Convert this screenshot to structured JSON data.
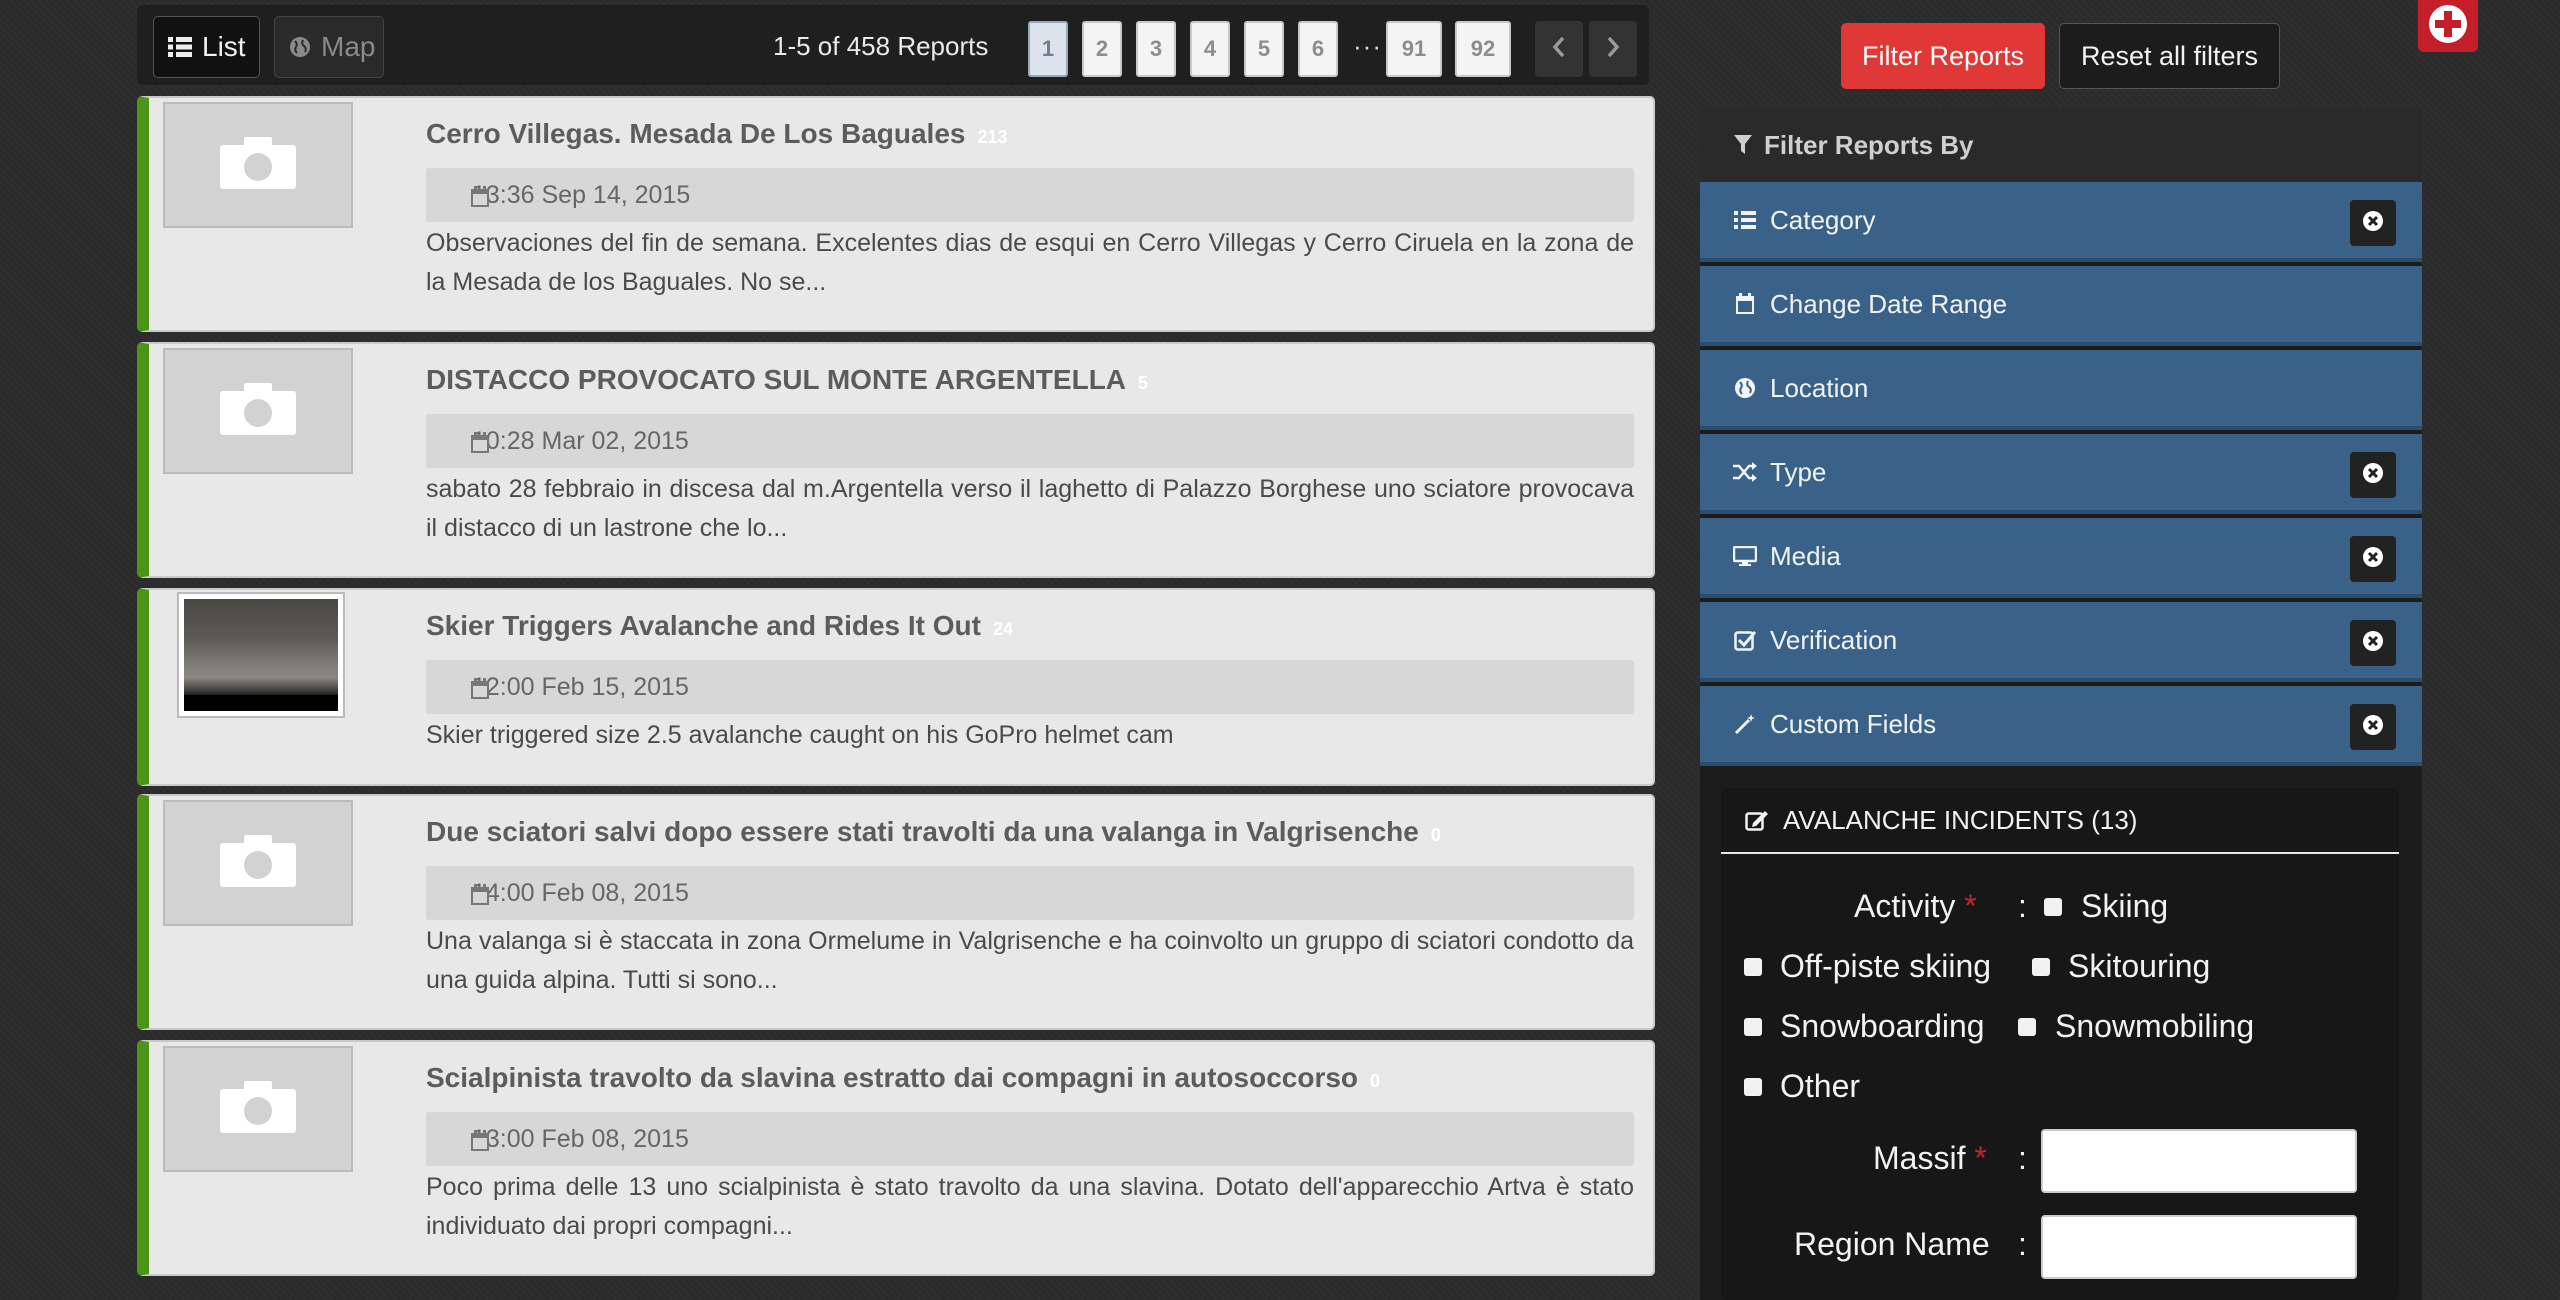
{
  "toolbar": {
    "list_label": "List",
    "map_label": "Map",
    "count_label": "1-5 of 458 Reports",
    "pages": [
      "1",
      "2",
      "3",
      "4",
      "5",
      "6"
    ],
    "ellipsis": "···",
    "last_pages": [
      "91",
      "92"
    ],
    "active_page": "1",
    "prev_icon": "chevron-left-icon",
    "next_icon": "chevron-right-icon"
  },
  "reports": [
    {
      "title": "Cerro Villegas. Mesada De Los Baguales",
      "count": "213",
      "date": "13:36 Sep 14, 2015",
      "description": "Observaciones del fin de semana. Excelentes dias de esqui en Cerro Villegas y Cerro Ciruela en la zona de la Mesada de los Baguales. No se...",
      "thumbnail": "camera-placeholder-icon"
    },
    {
      "title": "DISTACCO PROVOCATO SUL MONTE ARGENTELLA",
      "count": "5",
      "date": "10:28 Mar 02, 2015",
      "description": "sabato 28 febbraio in discesa dal m.Argentella verso il laghetto di Palazzo Borghese uno sciatore provocava il distacco di un lastrone che lo...",
      "thumbnail": "camera-placeholder-icon"
    },
    {
      "title": "Skier Triggers Avalanche and Rides It Out",
      "count": "24",
      "date": "12:00 Feb 15, 2015",
      "description": "Skier triggered size 2.5 avalanche caught on his GoPro helmet cam",
      "thumbnail": "video-thumbnail"
    },
    {
      "title": "Due sciatori salvi dopo essere stati travolti da una valanga in Valgrisenche",
      "count": "0",
      "date": "14:00 Feb 08, 2015",
      "description": "Una valanga si è staccata in zona Ormelume in Valgrisenche e ha coinvolto un gruppo di sciatori condotto da una guida alpina. Tutti si sono...",
      "thumbnail": "camera-placeholder-icon"
    },
    {
      "title": "Scialpinista travolto da slavina estratto dai compagni in autosoccorso",
      "count": "0",
      "date": "13:00 Feb 08, 2015",
      "description": "Poco prima delle 13 uno scialpinista è stato travolto da una slavina. Dotato dell'apparecchio Artva è stato individuato dai propri compagni...",
      "thumbnail": "camera-placeholder-icon"
    }
  ],
  "actions": {
    "filter_label": "Filter Reports",
    "reset_label": "Reset all filters",
    "add_icon": "plus-circle-icon"
  },
  "filter_panel": {
    "title": "Filter Reports By",
    "items": [
      {
        "label": "Category",
        "icon": "list-icon",
        "closable": true
      },
      {
        "label": "Change Date Range",
        "icon": "calendar-icon",
        "closable": false
      },
      {
        "label": "Location",
        "icon": "globe-icon",
        "closable": false
      },
      {
        "label": "Type",
        "icon": "shuffle-icon",
        "closable": true
      },
      {
        "label": "Media",
        "icon": "monitor-icon",
        "closable": true
      },
      {
        "label": "Verification",
        "icon": "check-square-icon",
        "closable": true
      },
      {
        "label": "Custom Fields",
        "icon": "magic-wand-icon",
        "closable": true
      }
    ]
  },
  "form": {
    "title": "AVALANCHE INCIDENTS (13)",
    "activity_label": "Activity",
    "required_mark": "*",
    "colon": ":",
    "activity_options": [
      "Skiing",
      "Off-piste skiing",
      "Skitouring",
      "Snowboarding",
      "Snowmobiling",
      "Other"
    ],
    "massif_label": "Massif",
    "massif_value": "",
    "region_label": "Region Name",
    "region_value": ""
  },
  "colors": {
    "accent_red": "#df3836",
    "filter_blue": "#3a6288",
    "report_green": "#4a9418"
  }
}
